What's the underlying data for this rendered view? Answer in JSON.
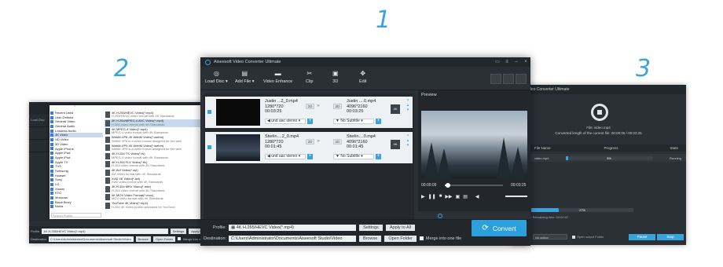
{
  "steps": {
    "one": "1",
    "two": "2",
    "three": "3"
  },
  "colors": {
    "accent": "#3ba3dc",
    "window_bg": "#2b3036",
    "convert_button": "#2ba0dd"
  },
  "main": {
    "title": "Aiseesoft Video Converter Ultimate",
    "toolbar": [
      {
        "label": "Load Disc",
        "icon": "disc-icon"
      },
      {
        "label": "Add File",
        "icon": "add-file-icon"
      },
      {
        "label": "Video Enhance",
        "icon": "enhance-icon"
      },
      {
        "label": "Clip",
        "icon": "scissors-icon"
      },
      {
        "label": "3D",
        "icon": "3d-icon"
      },
      {
        "label": "Edit",
        "icon": "edit-icon"
      }
    ],
    "files": [
      {
        "src_name": "Justin ...2_0.mp4",
        "src_res": "1280*720",
        "src_dur": "00:03:25",
        "dst_name": "Justin ....0.mp4",
        "dst_res": "4096*2160",
        "dst_dur": "00:03:25",
        "audio": "und aac stereo",
        "subtitle": "No Subtitle",
        "tag": "2D"
      },
      {
        "src_name": "Sterlin....2_0.mp4",
        "src_res": "1280*720",
        "src_dur": "00:01:45",
        "dst_name": "Sterlin....0.mp4",
        "dst_res": "4096*2160",
        "dst_dur": "00:01:45",
        "audio": "und aac stereo",
        "subtitle": "No Subtitle",
        "tag": "2D"
      }
    ],
    "preview": {
      "label": "Preview",
      "time_current": "00:00:09",
      "time_total": "00:03:25",
      "seek_fraction": 0.05
    },
    "profile_label": "Profile:",
    "profile_value": "4K H.265/HEVC Video(*.mp4)",
    "settings_btn": "Settings",
    "apply_all_btn": "Apply to All",
    "destination_label": "Destination:",
    "destination_value": "C:\\Users\\Administrator\\Documents\\Aiseesoft Studio\\Video",
    "browse_btn": "Browse",
    "open_folder_btn": "Open Folder",
    "merge_label": "Merge into one file",
    "convert_btn": "Convert"
  },
  "left": {
    "devices": [
      "Recent Used",
      "User Defined",
      "General Video",
      "General Audio",
      "Lossless Audio",
      "4K Video",
      "HD Video",
      "3D Video",
      "Apple iPhone",
      "Apple iPad",
      "Apple iPod",
      "Apple TV",
      "TVS",
      "Samsung",
      "Huawei",
      "Sony",
      "LG",
      "Xiaomi",
      "HTC",
      "Motorola",
      "Black Berry",
      "Nokia"
    ],
    "formats": [
      {
        "name": "4K H.265/HEVC Video(*.mp4)",
        "desc": "H.265/HEVC video format with 4K Standards"
      },
      {
        "name": "4K H.264/MPEG-4 AVC Video(*.mp4)",
        "desc": "H.264 video format with 4K Standards"
      },
      {
        "name": "4K MPEG-4 Video(*.mp4)",
        "desc": "MPEG-4 video format with 4K Standards"
      },
      {
        "name": "WebM-VP8 4K WebM Video(*.webm)",
        "desc": "WebM VP8 is a video format designed for the web"
      },
      {
        "name": "WebM-VP9 4K WebM Video(*.webm)",
        "desc": "WebM VP9 is a video format designed for the web"
      },
      {
        "name": "4K H.264 TS Video(*.ts)",
        "desc": "MPEG-4 video format with 4K Standards"
      },
      {
        "name": "4K H.264 FLV Video(*.flv)",
        "desc": "H.264 video format with 4K Standards"
      },
      {
        "name": "4K AVI Video(*.avi)",
        "desc": "AVI video format with 4K Standards"
      },
      {
        "name": "XviD 4K Video(*.avi)",
        "desc": "XviD video format with 4K Standards"
      },
      {
        "name": "4K H.264 MKV Video(*.mkv)",
        "desc": "H.264 video format with 4K Standards"
      },
      {
        "name": "4K MOV Video Format(*.mov)",
        "desc": "MOV video format with 4K Standards"
      },
      {
        "name": "YouTube 4K Video(*.mp4)",
        "desc": "H.264 4K Video profile optimized for YouTube"
      }
    ],
    "search_placeholder": "Search Profile...",
    "profile_label": "Profile",
    "profile_value": "4K H.265/HEVC Video(*.mp4)",
    "settings_btn": "Settings",
    "apply_btn": "Apply to All",
    "destination_label": "Destination",
    "destination_value": "C:\\Users\\Administrator\\Documents\\Aiseesoft Studio\\Video",
    "browse_btn": "Browse",
    "open_folder_btn": "Open Folder",
    "merge_label": "Merge into one file",
    "side": [
      "Load Disc",
      "",
      "",
      ""
    ]
  },
  "right": {
    "title": "t Video Converter Ultimate",
    "file_line": "File: video.mp4",
    "length_line": "Converted length of the current file: 00:00:06 / 00:03:25",
    "cols": [
      "File Name",
      "Progress",
      "State"
    ],
    "row": {
      "name": "video.mp4",
      "progress_text": "3%",
      "progress": 0.03,
      "state": "Running"
    },
    "overall_progress_text": "27%",
    "overall_progress": 0.27,
    "elapsed_line": "ime: 00:00:01 / Remaining time: 00:00:07",
    "overall_label": "ogress:",
    "after_select": "No action",
    "open_folder_label": "Open output Folder",
    "pause_btn": "Pause",
    "stop_btn": "Stop"
  }
}
